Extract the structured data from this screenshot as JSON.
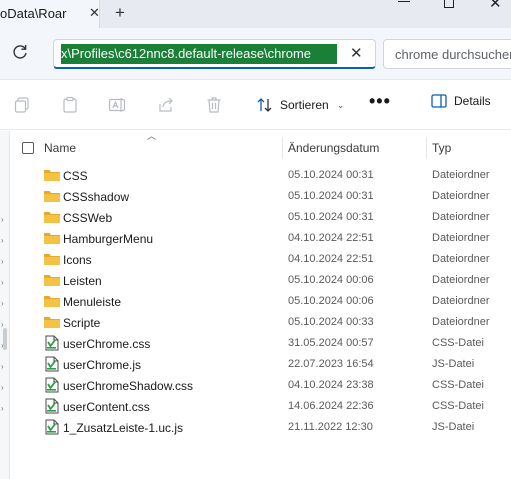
{
  "tab": {
    "title": "oData\\Roar",
    "close": "✕",
    "new": "+"
  },
  "window_controls": {
    "minimize": "—",
    "maximize": "☐",
    "close": "✕"
  },
  "address": {
    "value": "x\\Profiles\\c612nnc8.default-release\\chrome",
    "clear": "✕"
  },
  "search": {
    "placeholder": "chrome durchsuchen"
  },
  "toolbar": {
    "sort_label": "Sortieren",
    "more_label": "•••",
    "details_label": "Details",
    "icons": [
      "copy-icon",
      "paste-icon",
      "rename-icon",
      "share-icon",
      "delete-icon"
    ]
  },
  "columns": {
    "name": "Name",
    "date": "Änderungsdatum",
    "type": "Typ"
  },
  "files": [
    {
      "name": "CSS",
      "date": "05.10.2024 00:31",
      "type": "Dateiordner",
      "kind": "folder"
    },
    {
      "name": "CSSshadow",
      "date": "05.10.2024 00:31",
      "type": "Dateiordner",
      "kind": "folder"
    },
    {
      "name": "CSSWeb",
      "date": "05.10.2024 00:31",
      "type": "Dateiordner",
      "kind": "folder"
    },
    {
      "name": "HamburgerMenu",
      "date": "04.10.2024 22:51",
      "type": "Dateiordner",
      "kind": "folder"
    },
    {
      "name": "Icons",
      "date": "04.10.2024 22:51",
      "type": "Dateiordner",
      "kind": "folder"
    },
    {
      "name": "Leisten",
      "date": "05.10.2024 00:06",
      "type": "Dateiordner",
      "kind": "folder"
    },
    {
      "name": "Menuleiste",
      "date": "05.10.2024 00:06",
      "type": "Dateiordner",
      "kind": "folder"
    },
    {
      "name": "Scripte",
      "date": "05.10.2024 00:33",
      "type": "Dateiordner",
      "kind": "folder"
    },
    {
      "name": "userChrome.css",
      "date": "31.05.2024 00:57",
      "type": "CSS-Datei",
      "kind": "file"
    },
    {
      "name": "userChrome.js",
      "date": "22.07.2023 16:54",
      "type": "JS-Datei",
      "kind": "file"
    },
    {
      "name": "userChromeShadow.css",
      "date": "04.10.2024 23:38",
      "type": "CSS-Datei",
      "kind": "file"
    },
    {
      "name": "userContent.css",
      "date": "14.06.2024 22:36",
      "type": "CSS-Datei",
      "kind": "file"
    },
    {
      "name": "1_ZusatzLeiste-1.uc.js",
      "date": "21.11.2022 12:30",
      "type": "JS-Datei",
      "kind": "file"
    }
  ],
  "colors": {
    "selection": "#1a7f37",
    "accent": "#0a5fb0",
    "folder": "#f4c245"
  }
}
